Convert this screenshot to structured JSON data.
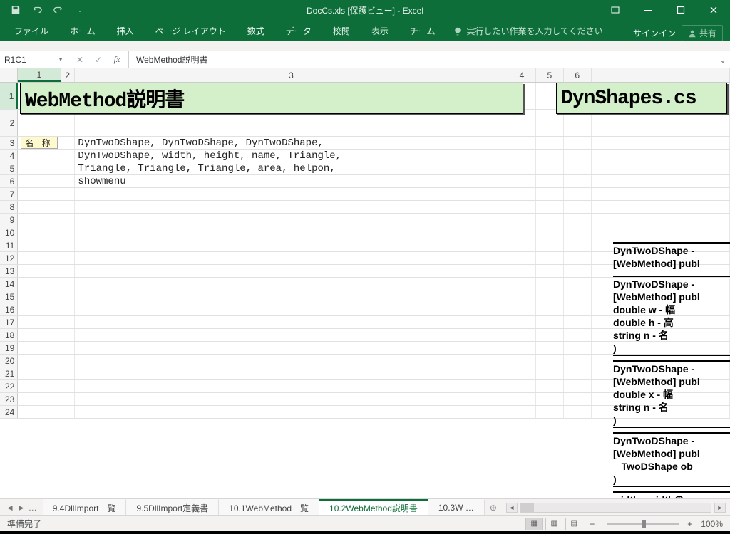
{
  "title": "DocCs.xls [保護ビュー] - Excel",
  "ribbon": {
    "tabs": [
      "ファイル",
      "ホーム",
      "挿入",
      "ページ レイアウト",
      "数式",
      "データ",
      "校閲",
      "表示",
      "チーム"
    ],
    "tell_me": "実行したい作業を入力してください",
    "signin": "サインイン",
    "share": "共有"
  },
  "formula": {
    "name_box": "R1C1",
    "value": "WebMethod説明書"
  },
  "columns": [
    "1",
    "2",
    "3",
    "4",
    "5",
    "6",
    ""
  ],
  "big_title_left": "WebMethod説明書",
  "big_title_right": "DynShapes.cs",
  "label_box": "名 称",
  "body_lines": [
    "DynTwoDShape, DynTwoDShape, DynTwoDShape,",
    "DynTwoDShape, width, height, name, Triangle,",
    "Triangle, Triangle, Triangle, area, helpon,",
    "showmenu"
  ],
  "right_blocks": [
    {
      "lines": [
        "DynTwoDShape - ",
        "[WebMethod] publ"
      ]
    },
    {
      "lines": [
        "DynTwoDShape - ",
        "[WebMethod] publ",
        "  double w  - 幅",
        "  double h  - 高",
        "  string n  - 名",
        ")"
      ]
    },
    {
      "lines": [
        "DynTwoDShape - ",
        "[WebMethod] publ",
        "  double x  - 幅",
        "  string n  - 名",
        ")"
      ]
    },
    {
      "lines": [
        "DynTwoDShape - ",
        "[WebMethod] publ",
        "  TwoDShape ob",
        ")"
      ]
    },
    {
      "lines": [
        "width - widthの"
      ]
    }
  ],
  "sheets": {
    "list": [
      "9.4DllImport一覧",
      "9.5DllImport定義書",
      "10.1WebMethod一覧",
      "10.2WebMethod説明書",
      "10.3W …"
    ],
    "active_index": 3
  },
  "status": {
    "ready": "準備完了",
    "zoom": "100%"
  }
}
